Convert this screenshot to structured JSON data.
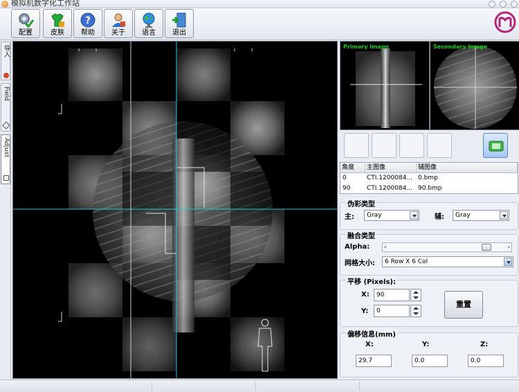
{
  "window": {
    "title": "模拟机数字化工作站"
  },
  "toolbar": {
    "buttons": [
      {
        "label": "配置",
        "icon": "config-check-icon"
      },
      {
        "label": "皮肤",
        "icon": "skin-shirt-icon"
      },
      {
        "label": "帮助",
        "icon": "help-question-icon"
      },
      {
        "label": "关于",
        "icon": "about-user-icon"
      },
      {
        "label": "语言",
        "icon": "language-globe-icon"
      },
      {
        "label": "退出",
        "icon": "exit-door-icon"
      }
    ],
    "brand_icon": "brand-logo-icon"
  },
  "left_tabs": [
    {
      "label": "导入",
      "icon": "import-icon"
    },
    {
      "label": "Field",
      "icon": "field-icon"
    },
    {
      "label": "Adjust",
      "icon": "adjust-icon"
    }
  ],
  "thumbnails": {
    "primary_label": "Primary Image",
    "secondary_label": "Secondary Image"
  },
  "image_table": {
    "headers": [
      "角度",
      "主图像",
      "辅图像"
    ],
    "rows": [
      [
        "0",
        "CTI.1200084...",
        "0.bmp"
      ],
      [
        "90",
        "CTI.1200084...",
        "90.bmp"
      ]
    ]
  },
  "pseudo_color": {
    "title": "伪彩类型",
    "primary_label": "主:",
    "primary_value": "Gray",
    "secondary_label": "辅:",
    "secondary_value": "Gray"
  },
  "fusion": {
    "title": "融合类型",
    "alpha_label": "Alpha:",
    "alpha_fraction": 0.85,
    "grid_label": "网格大小:",
    "grid_value": "6 Row X 6 Col"
  },
  "translate": {
    "title": "平移 (Pixels):",
    "x_label": "X:",
    "x_value": "90",
    "y_label": "Y:",
    "y_value": "0",
    "reset_label": "重置"
  },
  "offset": {
    "title": "偏移信息(mm)",
    "x_label": "X:",
    "y_label": "Y:",
    "z_label": "Z:",
    "x_value": "29.7",
    "y_value": "0.0",
    "z_value": "0.0"
  },
  "colors": {
    "crosshair": "#22c8dc",
    "thumb_label": "#19c319",
    "accent": "#3a7bd5"
  }
}
